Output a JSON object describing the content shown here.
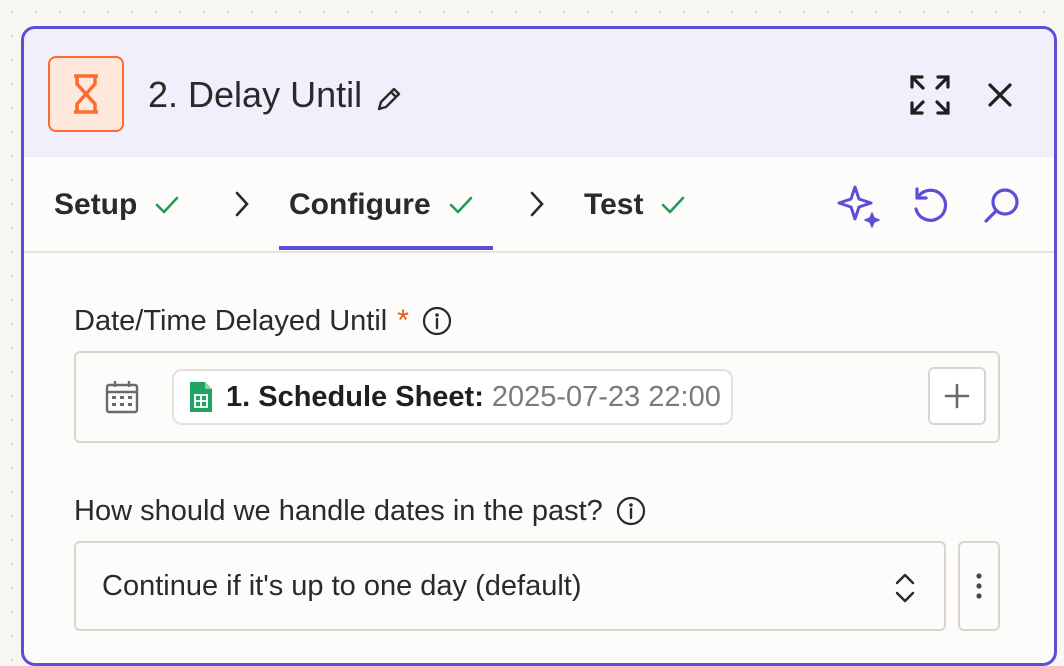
{
  "header": {
    "title": "2. Delay Until",
    "app_icon": "hourglass-icon",
    "accent_color": "#ff6a2e"
  },
  "tabs": [
    {
      "label": "Setup",
      "status": "complete"
    },
    {
      "label": "Configure",
      "status": "complete",
      "active": true
    },
    {
      "label": "Test",
      "status": "complete"
    }
  ],
  "toolbar_icons": [
    "ai-sparkle-icon",
    "undo-icon",
    "search-icon"
  ],
  "fields": {
    "datetime": {
      "label": "Date/Time Delayed Until",
      "required_marker": "*",
      "pill_label": "1. Schedule Sheet:",
      "pill_value": "2025-07-23 22:00"
    },
    "past_dates": {
      "label": "How should we handle dates in the past?",
      "selected": "Continue if it's up to one day (default)"
    }
  },
  "colors": {
    "brand_purple": "#5b4fd6",
    "check_green": "#1f9d55",
    "required_orange": "#e8590c"
  }
}
